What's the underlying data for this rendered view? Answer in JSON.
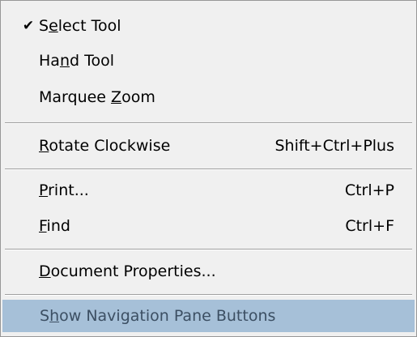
{
  "menu": {
    "items": [
      {
        "check": "✔",
        "prefix": "S",
        "mnemonic": "e",
        "suffix": "lect Tool",
        "shortcut": ""
      },
      {
        "check": "",
        "prefix": "Ha",
        "mnemonic": "n",
        "suffix": "d Tool",
        "shortcut": ""
      },
      {
        "check": "",
        "prefix": "Marquee ",
        "mnemonic": "Z",
        "suffix": "oom",
        "shortcut": ""
      },
      {
        "check": "",
        "prefix": "",
        "mnemonic": "R",
        "suffix": "otate Clockwise",
        "shortcut": "Shift+Ctrl+Plus"
      },
      {
        "check": "",
        "prefix": "",
        "mnemonic": "P",
        "suffix": "rint...",
        "shortcut": "Ctrl+P"
      },
      {
        "check": "",
        "prefix": "",
        "mnemonic": "F",
        "suffix": "ind",
        "shortcut": "Ctrl+F"
      },
      {
        "check": "",
        "prefix": "",
        "mnemonic": "D",
        "suffix": "ocument Properties...",
        "shortcut": ""
      },
      {
        "check": "",
        "prefix": "S",
        "mnemonic": "h",
        "suffix": "ow Navigation Pane Buttons",
        "shortcut": ""
      }
    ]
  },
  "colors": {
    "menu_background": "#f0f0f0",
    "highlight_background": "#a6c0d8",
    "highlight_text": "#3c4f63",
    "separator": "#a0a0a0"
  }
}
